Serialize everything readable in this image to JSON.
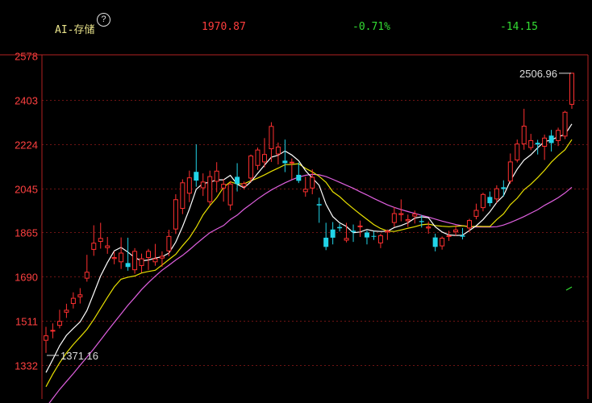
{
  "header": {
    "title": "AI-存储",
    "help_icon": "?",
    "last_price": "1970.87",
    "change_pct": "-0.71%",
    "change": "-14.15",
    "colors": {
      "title": "#e8e28a",
      "up": "#ff3d3d",
      "down": "#33dd33"
    }
  },
  "chart_data": {
    "type": "candlestick",
    "title": "",
    "xlabel": "",
    "ylabel": "",
    "ylim": [
      1332,
      2578
    ],
    "y_ticks": [
      "2578",
      "2403",
      "2224",
      "2045",
      "1865",
      "1690",
      "1511",
      "1332"
    ],
    "grid": true,
    "annotations": {
      "high": "2506.96",
      "low": "1371.16"
    },
    "colors": {
      "up": "#ff3030",
      "down": "#21d4e8",
      "ma5": "#ffffff",
      "ma10": "#e8e000",
      "ma20": "#e060e0",
      "axis": "#b22222",
      "tick_text": "#ff4040"
    },
    "candles": [
      [
        1432,
        1486,
        1450,
        1381
      ],
      [
        1470,
        1500,
        1472,
        1440
      ],
      [
        1492,
        1555,
        1508,
        1480
      ],
      [
        1545,
        1579,
        1553,
        1522
      ],
      [
        1580,
        1625,
        1601,
        1560
      ],
      [
        1607,
        1642,
        1615,
        1580
      ],
      [
        1682,
        1776,
        1706,
        1668
      ],
      [
        1798,
        1895,
        1823,
        1772
      ],
      [
        1830,
        1905,
        1842,
        1801
      ],
      [
        1805,
        1848,
        1812,
        1780
      ],
      [
        1761,
        1790,
        1765,
        1738
      ],
      [
        1748,
        1846,
        1783,
        1719
      ],
      [
        1743,
        1845,
        1727,
        1712
      ],
      [
        1716,
        1803,
        1790,
        1700
      ],
      [
        1733,
        1781,
        1760,
        1705
      ],
      [
        1765,
        1800,
        1790,
        1715
      ],
      [
        1748,
        1820,
        1760,
        1732
      ],
      [
        1763,
        1790,
        1770,
        1728
      ],
      [
        1792,
        1877,
        1850,
        1770
      ],
      [
        1880,
        2020,
        1998,
        1860
      ],
      [
        1963,
        2080,
        2066,
        1940
      ],
      [
        2024,
        2115,
        2086,
        1988
      ],
      [
        2110,
        2221,
        2075,
        2050
      ],
      [
        2046,
        2104,
        2069,
        2013
      ],
      [
        1990,
        2115,
        2091,
        1975
      ],
      [
        2072,
        2149,
        2113,
        2028
      ],
      [
        2045,
        2081,
        2060,
        1990
      ],
      [
        1977,
        2073,
        2061,
        1955
      ],
      [
        2090,
        2145,
        2061,
        2031
      ],
      [
        2052,
        2071,
        2063,
        2040
      ],
      [
        2085,
        2180,
        2174,
        2069
      ],
      [
        2136,
        2208,
        2198,
        2118
      ],
      [
        2150,
        2246,
        2180,
        2128
      ],
      [
        2203,
        2310,
        2293,
        2150
      ],
      [
        2182,
        2228,
        2210,
        2140
      ],
      [
        2155,
        2240,
        2145,
        2109
      ],
      [
        2148,
        2164,
        2149,
        2080
      ],
      [
        2098,
        2148,
        2074,
        2065
      ],
      [
        2030,
        2090,
        2040,
        2010
      ],
      [
        2045,
        2120,
        2088,
        2020
      ],
      [
        1980,
        2006,
        1975,
        1905
      ],
      [
        1845,
        1905,
        1808,
        1795
      ],
      [
        1878,
        1908,
        1845,
        1818
      ],
      [
        1888,
        1901,
        1883,
        1870
      ],
      [
        1835,
        1905,
        1842,
        1826
      ],
      [
        1873,
        1898,
        1868,
        1828
      ],
      [
        1889,
        1914,
        1892,
        1848
      ],
      [
        1866,
        1874,
        1846,
        1818
      ],
      [
        1852,
        1871,
        1851,
        1836
      ],
      [
        1824,
        1861,
        1853,
        1803
      ],
      [
        1868,
        1878,
        1872,
        1836
      ],
      [
        1906,
        1968,
        1942,
        1889
      ],
      [
        1938,
        1999,
        1942,
        1911
      ],
      [
        1913,
        1938,
        1918,
        1888
      ],
      [
        1932,
        1954,
        1940,
        1902
      ],
      [
        1912,
        1936,
        1908,
        1886
      ],
      [
        1884,
        1910,
        1888,
        1861
      ],
      [
        1846,
        1861,
        1808,
        1790
      ],
      [
        1812,
        1850,
        1843,
        1797
      ],
      [
        1852,
        1873,
        1853,
        1832
      ],
      [
        1869,
        1895,
        1876,
        1852
      ],
      [
        1854,
        1884,
        1849,
        1838
      ],
      [
        1884,
        1921,
        1914,
        1868
      ],
      [
        1931,
        1982,
        1955,
        1919
      ],
      [
        1966,
        2026,
        2019,
        1951
      ],
      [
        2009,
        2031,
        1984,
        1971
      ],
      [
        2001,
        2056,
        2042,
        1985
      ],
      [
        2048,
        2076,
        2041,
        2011
      ],
      [
        2073,
        2184,
        2150,
        2062
      ],
      [
        2158,
        2240,
        2222,
        2148
      ],
      [
        2223,
        2364,
        2294,
        2199
      ],
      [
        2208,
        2263,
        2236,
        2197
      ],
      [
        2227,
        2239,
        2220,
        2180
      ],
      [
        2213,
        2260,
        2246,
        2158
      ],
      [
        2256,
        2279,
        2226,
        2192
      ],
      [
        2236,
        2288,
        2277,
        2214
      ],
      [
        2254,
        2356,
        2350,
        2242
      ],
      [
        2382,
        2497,
        2507,
        2364
      ]
    ],
    "ma5": [
      1302,
      1355,
      1410,
      1452,
      1480,
      1506,
      1552,
      1621,
      1691,
      1745,
      1792,
      1806,
      1787,
      1765,
      1752,
      1755,
      1763,
      1768,
      1783,
      1827,
      1890,
      1960,
      2040,
      2064,
      2068,
      2078,
      2078,
      2096,
      2060,
      2046,
      2070,
      2104,
      2137,
      2169,
      2177,
      2194,
      2178,
      2155,
      2115,
      2085,
      2056,
      1980,
      1930,
      1905,
      1890,
      1865,
      1868,
      1878,
      1872,
      1870,
      1871,
      1886,
      1894,
      1905,
      1924,
      1929,
      1925,
      1889,
      1868,
      1856,
      1854,
      1855,
      1874,
      1893,
      1918,
      1949,
      1987,
      2014,
      2074,
      2121,
      2157,
      2179,
      2207,
      2232,
      2238,
      2252,
      2260,
      2303
    ],
    "ma10": [
      1245,
      1296,
      1341,
      1381,
      1415,
      1445,
      1476,
      1516,
      1560,
      1605,
      1647,
      1678,
      1686,
      1691,
      1703,
      1709,
      1714,
      1735,
      1757,
      1778,
      1813,
      1844,
      1887,
      1937,
      1974,
      2006,
      2048,
      2070,
      2061,
      2062,
      2074,
      2085,
      2098,
      2112,
      2125,
      2139,
      2140,
      2143,
      2124,
      2110,
      2092,
      2068,
      2030,
      2010,
      1985,
      1962,
      1940,
      1919,
      1898,
      1882,
      1872,
      1870,
      1876,
      1883,
      1889,
      1897,
      1900,
      1894,
      1891,
      1889,
      1891,
      1893,
      1889,
      1891,
      1890,
      1890,
      1918,
      1941,
      1978,
      2004,
      2038,
      2060,
      2087,
      2116,
      2149,
      2176,
      2199,
      2240
    ],
    "ma20": [
      1162,
      1198,
      1234,
      1266,
      1298,
      1331,
      1364,
      1398,
      1433,
      1469,
      1504,
      1538,
      1573,
      1604,
      1636,
      1664,
      1690,
      1714,
      1734,
      1755,
      1774,
      1796,
      1820,
      1843,
      1865,
      1880,
      1894,
      1918,
      1936,
      1960,
      1980,
      2001,
      2020,
      2037,
      2052,
      2066,
      2078,
      2089,
      2096,
      2100,
      2098,
      2091,
      2080,
      2068,
      2056,
      2044,
      2030,
      2017,
      2003,
      1990,
      1977,
      1967,
      1958,
      1950,
      1943,
      1935,
      1928,
      1920,
      1912,
      1905,
      1898,
      1893,
      1890,
      1888,
      1888,
      1888,
      1889,
      1896,
      1906,
      1918,
      1930,
      1944,
      1958,
      1975,
      1990,
      2006,
      2025,
      2048
    ]
  }
}
